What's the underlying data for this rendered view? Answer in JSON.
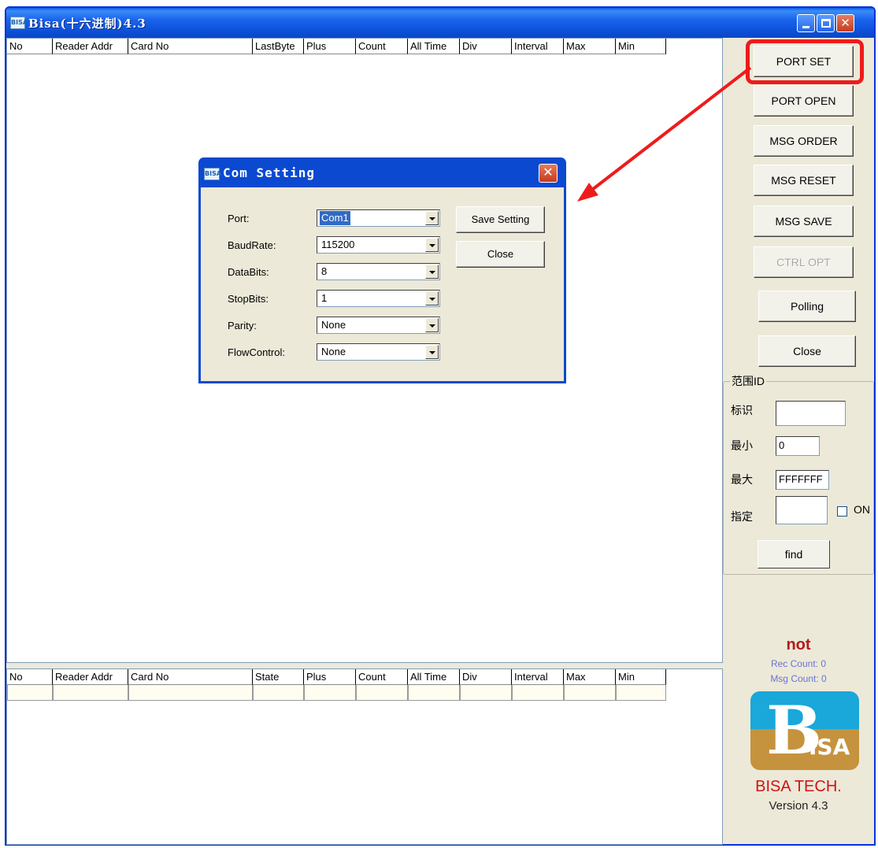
{
  "window": {
    "title": "Bisa(十六进制)4.3",
    "icon_text": "BISA",
    "icon": "app-icon",
    "controls": [
      "minimize-icon",
      "maximize-icon",
      "close-icon"
    ]
  },
  "top_list": {
    "columns": [
      "No",
      "Reader Addr",
      "Card No",
      "LastByte",
      "Plus",
      "Count",
      "All Time",
      "Div",
      "Interval",
      "Max",
      "Min"
    ]
  },
  "bottom_list": {
    "columns": [
      "No",
      "Reader Addr",
      "Card No",
      "State",
      "Plus",
      "Count",
      "All Time",
      "Div",
      "Interval",
      "Max",
      "Min"
    ]
  },
  "right_panel": {
    "buttons": [
      {
        "label": "PORT  SET",
        "enabled": true
      },
      {
        "label": "PORT OPEN",
        "enabled": true
      },
      {
        "label": "MSG ORDER",
        "enabled": true
      },
      {
        "label": "MSG RESET",
        "enabled": true
      },
      {
        "label": "MSG SAVE",
        "enabled": true
      },
      {
        "label": "CTRL OPT",
        "enabled": false
      },
      {
        "label": "Polling",
        "enabled": true
      },
      {
        "label": "Close",
        "enabled": true
      }
    ],
    "group": {
      "title": "范围ID",
      "id_label": "标识",
      "id_value": "",
      "min_label": "最小",
      "min_value": "0",
      "max_label": "最大",
      "max_value": "FFFFFFF",
      "assign_label": "指定",
      "assign_value": "",
      "on_label": "ON",
      "on_checked": false,
      "find_label": "find"
    },
    "status": "not",
    "rec_count": "Rec Count: 0",
    "msg_count": "Msg Count: 0",
    "logo_text_b": "B",
    "logo_text_isa": "ISA",
    "company": "BISA TECH.",
    "version": "Version 4.3",
    "colors": {
      "status": "#b31b1b",
      "counts": "#6b72d6",
      "logo_blue": "#1aa7d9",
      "logo_gold": "#c5933d",
      "company": "#d11414"
    }
  },
  "dialog": {
    "title": "Com Setting",
    "icon_text": "BISA",
    "fields": [
      {
        "label": "Port:",
        "value": "Com1",
        "selected": true
      },
      {
        "label": "BaudRate:",
        "value": "115200",
        "selected": false
      },
      {
        "label": "DataBits:",
        "value": "8",
        "selected": false
      },
      {
        "label": "StopBits:",
        "value": "1",
        "selected": false
      },
      {
        "label": "Parity:",
        "value": "None",
        "selected": false
      },
      {
        "label": "FlowControl:",
        "value": "None",
        "selected": false
      }
    ],
    "save_label": "Save Setting",
    "close_label": "Close"
  },
  "annotation": {
    "color": "#ee1b1b",
    "target": "PORT  SET"
  }
}
